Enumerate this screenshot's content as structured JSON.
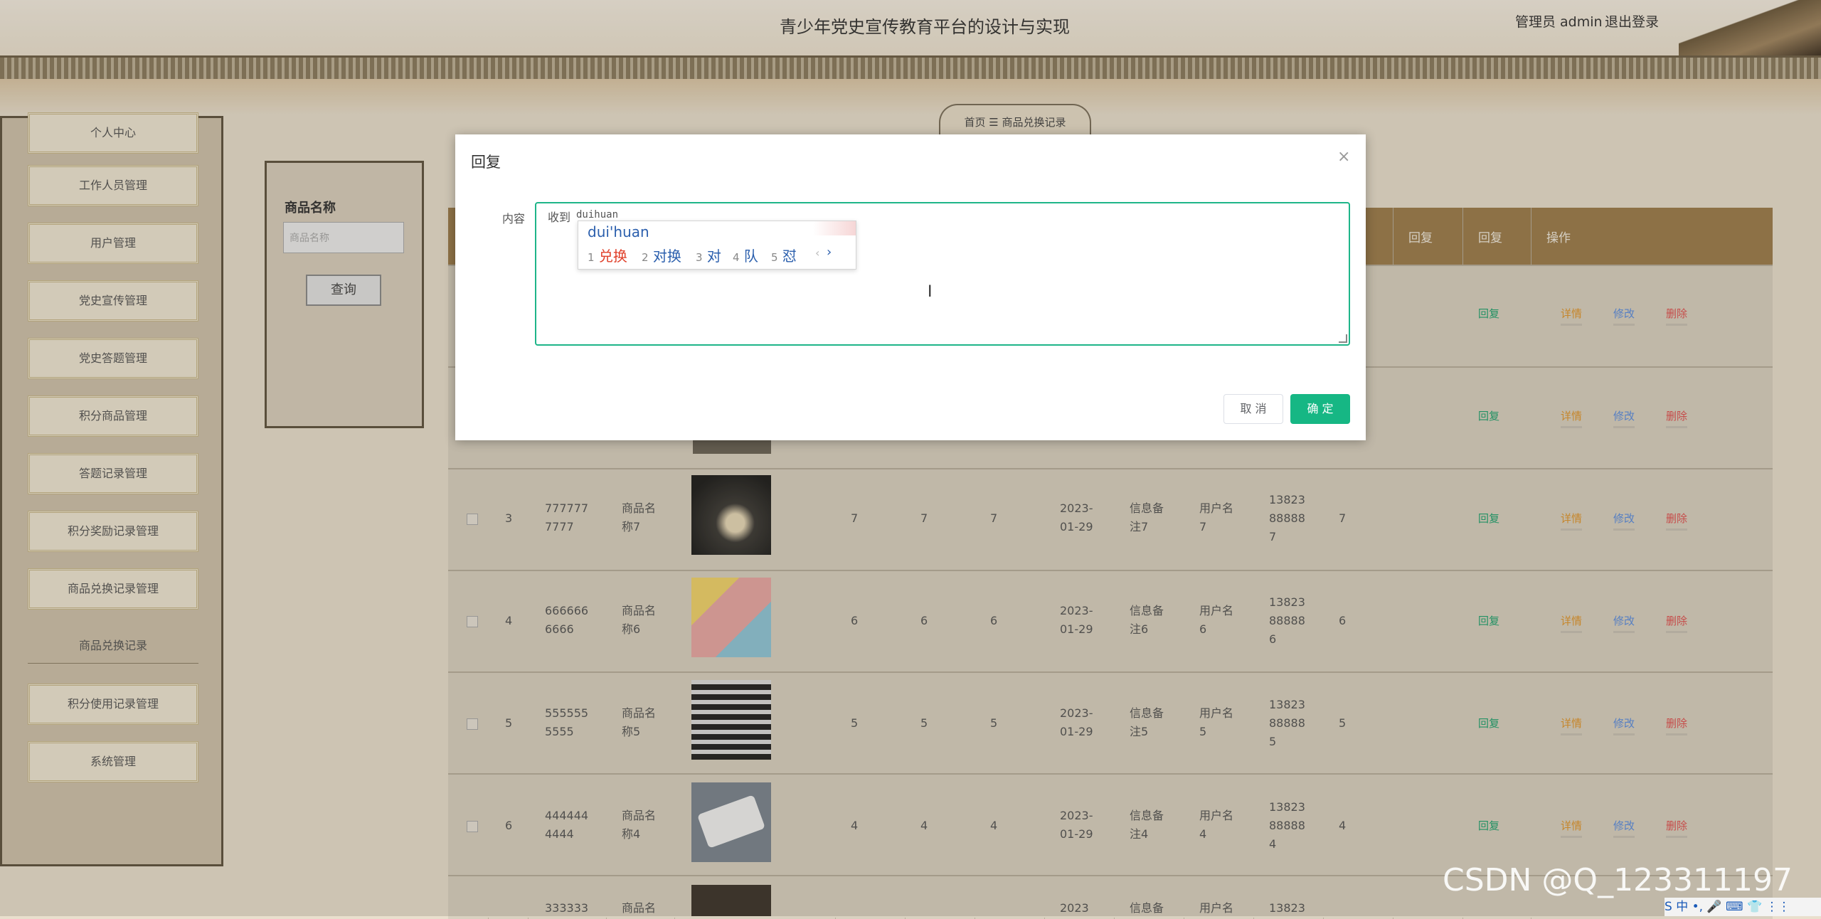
{
  "header": {
    "title": "青少年党史宣传教育平台的设计与实现",
    "admin": "管理员 admin",
    "logout": "退出登录"
  },
  "sidebar": {
    "items": [
      "个人中心",
      "工作人员管理",
      "用户管理",
      "党史宣传管理",
      "党史答题管理",
      "积分商品管理",
      "答题记录管理",
      "积分奖励记录管理",
      "商品兑换记录管理"
    ],
    "sub_item": "商品兑换记录",
    "items_after": [
      "积分使用记录管理",
      "系统管理"
    ]
  },
  "breadcrumb": {
    "home": "首页",
    "sep": "☰",
    "current": "商品兑换记录"
  },
  "search": {
    "label": "商品名称",
    "placeholder": "商品名称",
    "button": "查询"
  },
  "table": {
    "headers": {
      "reply1": "回复",
      "reply2": "回复",
      "ops": "操作"
    },
    "rows": [
      {
        "idx": "3",
        "code": "777777\n7777",
        "name": "商品名\n称7",
        "a": "7",
        "b": "7",
        "c": "7",
        "date": "2023-\n01-29",
        "note": "信息备\n注7",
        "user": "用户名\n7",
        "phone": "13823\n88888\n7",
        "n": "7"
      },
      {
        "idx": "4",
        "code": "666666\n6666",
        "name": "商品名\n称6",
        "a": "6",
        "b": "6",
        "c": "6",
        "date": "2023-\n01-29",
        "note": "信息备\n注6",
        "user": "用户名\n6",
        "phone": "13823\n88888\n6",
        "n": "6"
      },
      {
        "idx": "5",
        "code": "555555\n5555",
        "name": "商品名\n称5",
        "a": "5",
        "b": "5",
        "c": "5",
        "date": "2023-\n01-29",
        "note": "信息备\n注5",
        "user": "用户名\n5",
        "phone": "13823\n88888\n5",
        "n": "5"
      },
      {
        "idx": "6",
        "code": "444444\n4444",
        "name": "商品名\n称4",
        "a": "4",
        "b": "4",
        "c": "4",
        "date": "2023-\n01-29",
        "note": "信息备\n注4",
        "user": "用户名\n4",
        "phone": "13823\n88888\n4",
        "n": "4"
      }
    ],
    "last_row": {
      "code": "333333",
      "name": "商品名",
      "date": "2023",
      "note": "信息备",
      "user": "用户名",
      "phone": "13823"
    },
    "actions": {
      "reply": "回复",
      "detail": "详情",
      "edit": "修改",
      "delete": "删除"
    }
  },
  "modal": {
    "title": "回复",
    "close": "×",
    "field_label": "内容",
    "content": "收到",
    "typed_pinyin": "duihuan",
    "cancel": "取 消",
    "confirm": "确 定"
  },
  "ime": {
    "pinyin": "dui'huan",
    "candidates": [
      {
        "num": "1",
        "text": "兑换",
        "color": "#e0402a"
      },
      {
        "num": "2",
        "text": "对换",
        "color": "#2b5fad"
      },
      {
        "num": "3",
        "text": "对",
        "color": "#2b5fad"
      },
      {
        "num": "4",
        "text": "队",
        "color": "#2b5fad"
      },
      {
        "num": "5",
        "text": "怼",
        "color": "#2b5fad"
      }
    ],
    "prev": "‹",
    "next": "›",
    "tray": "S 中 •, 🎤 ⌨ 👕 ⋮⋮"
  },
  "watermark": "CSDN @Q_123311197"
}
